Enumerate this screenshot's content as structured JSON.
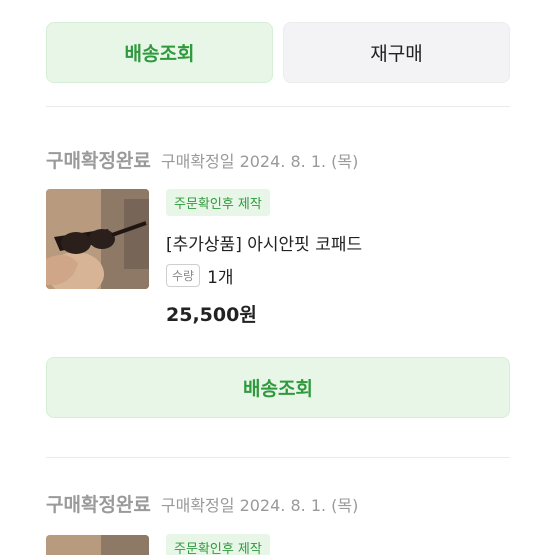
{
  "top_buttons": {
    "track_label": "배송조회",
    "reorder_label": "재구매"
  },
  "orders": [
    {
      "status": "구매확정완료",
      "date_text": "구매확정일 2024. 8. 1. (목)",
      "badge": "주문확인후 제작",
      "product_name": "[추가상품] 아시안핏 코패드",
      "qty_label": "수량",
      "qty_value": "1개",
      "price": "25,500원",
      "track_label": "배송조회",
      "image_icon": "sunglasses-photo"
    },
    {
      "status": "구매확정완료",
      "date_text": "구매확정일 2024. 8. 1. (목)",
      "badge": "주문확인후 제작",
      "image_icon": "sunglasses-photo"
    }
  ],
  "colors": {
    "accent_green": "#2f9a3d",
    "green_bg": "#e8f6e8",
    "muted_text": "#9a9a9a"
  }
}
